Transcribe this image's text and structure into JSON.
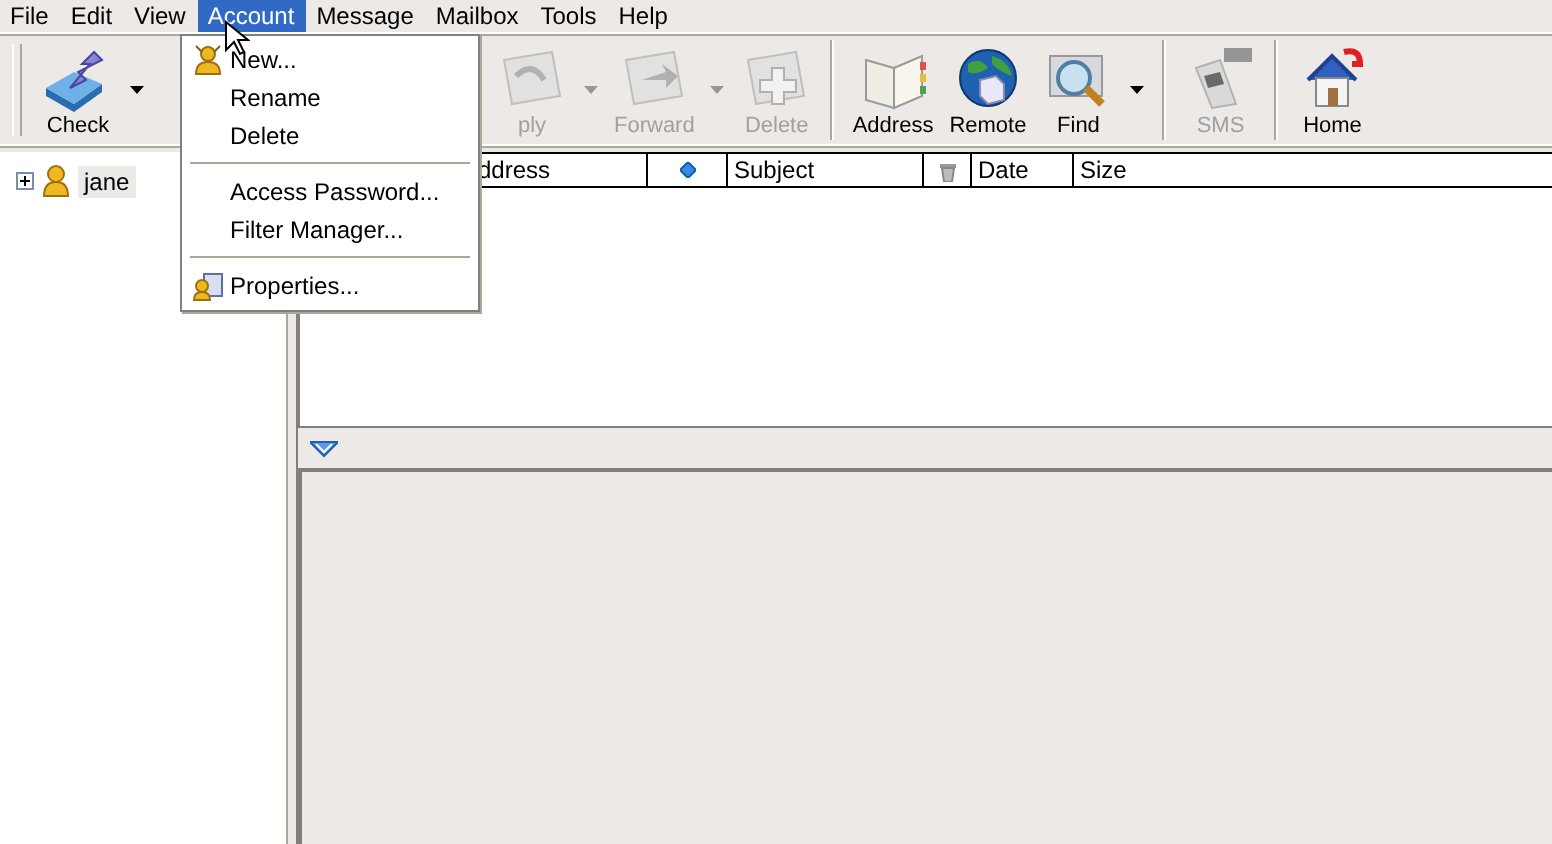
{
  "menubar": [
    {
      "label": "File",
      "selected": false
    },
    {
      "label": "Edit",
      "selected": false
    },
    {
      "label": "View",
      "selected": false
    },
    {
      "label": "Account",
      "selected": true
    },
    {
      "label": "Message",
      "selected": false
    },
    {
      "label": "Mailbox",
      "selected": false
    },
    {
      "label": "Tools",
      "selected": false
    },
    {
      "label": "Help",
      "selected": false
    }
  ],
  "toolbar": [
    {
      "kind": "button",
      "label": "Check",
      "disabled": false,
      "dropdown": true
    },
    {
      "kind": "gap"
    },
    {
      "kind": "button",
      "label": "ply",
      "disabled": true,
      "dropdown": true
    },
    {
      "kind": "button",
      "label": "Forward",
      "disabled": true,
      "dropdown": true
    },
    {
      "kind": "button",
      "label": "Delete",
      "disabled": true,
      "dropdown": false
    },
    {
      "kind": "separator"
    },
    {
      "kind": "button",
      "label": "Address",
      "disabled": false,
      "dropdown": false
    },
    {
      "kind": "button",
      "label": "Remote",
      "disabled": false,
      "dropdown": false
    },
    {
      "kind": "button",
      "label": "Find",
      "disabled": false,
      "dropdown": true
    },
    {
      "kind": "separator"
    },
    {
      "kind": "button",
      "label": "SMS",
      "disabled": true,
      "dropdown": false
    },
    {
      "kind": "separator"
    },
    {
      "kind": "button",
      "label": "Home",
      "disabled": false,
      "dropdown": false
    }
  ],
  "tree": [
    {
      "label": "jane",
      "expanded": false,
      "selected": true
    }
  ],
  "columns": [
    {
      "kind": "text",
      "label": "ddress"
    },
    {
      "kind": "flag"
    },
    {
      "kind": "text",
      "label": "Subject"
    },
    {
      "kind": "trash"
    },
    {
      "kind": "text",
      "label": "Date"
    },
    {
      "kind": "text",
      "label": "Size"
    }
  ],
  "account_menu": [
    {
      "kind": "item",
      "label": "New...",
      "icon": true
    },
    {
      "kind": "item",
      "label": "Rename",
      "icon": false
    },
    {
      "kind": "item",
      "label": "Delete",
      "icon": false
    },
    {
      "kind": "separator"
    },
    {
      "kind": "item",
      "label": "Access Password...",
      "icon": false
    },
    {
      "kind": "item",
      "label": "Filter Manager...",
      "icon": false
    },
    {
      "kind": "separator"
    },
    {
      "kind": "item",
      "label": "Properties...",
      "icon": true
    }
  ]
}
